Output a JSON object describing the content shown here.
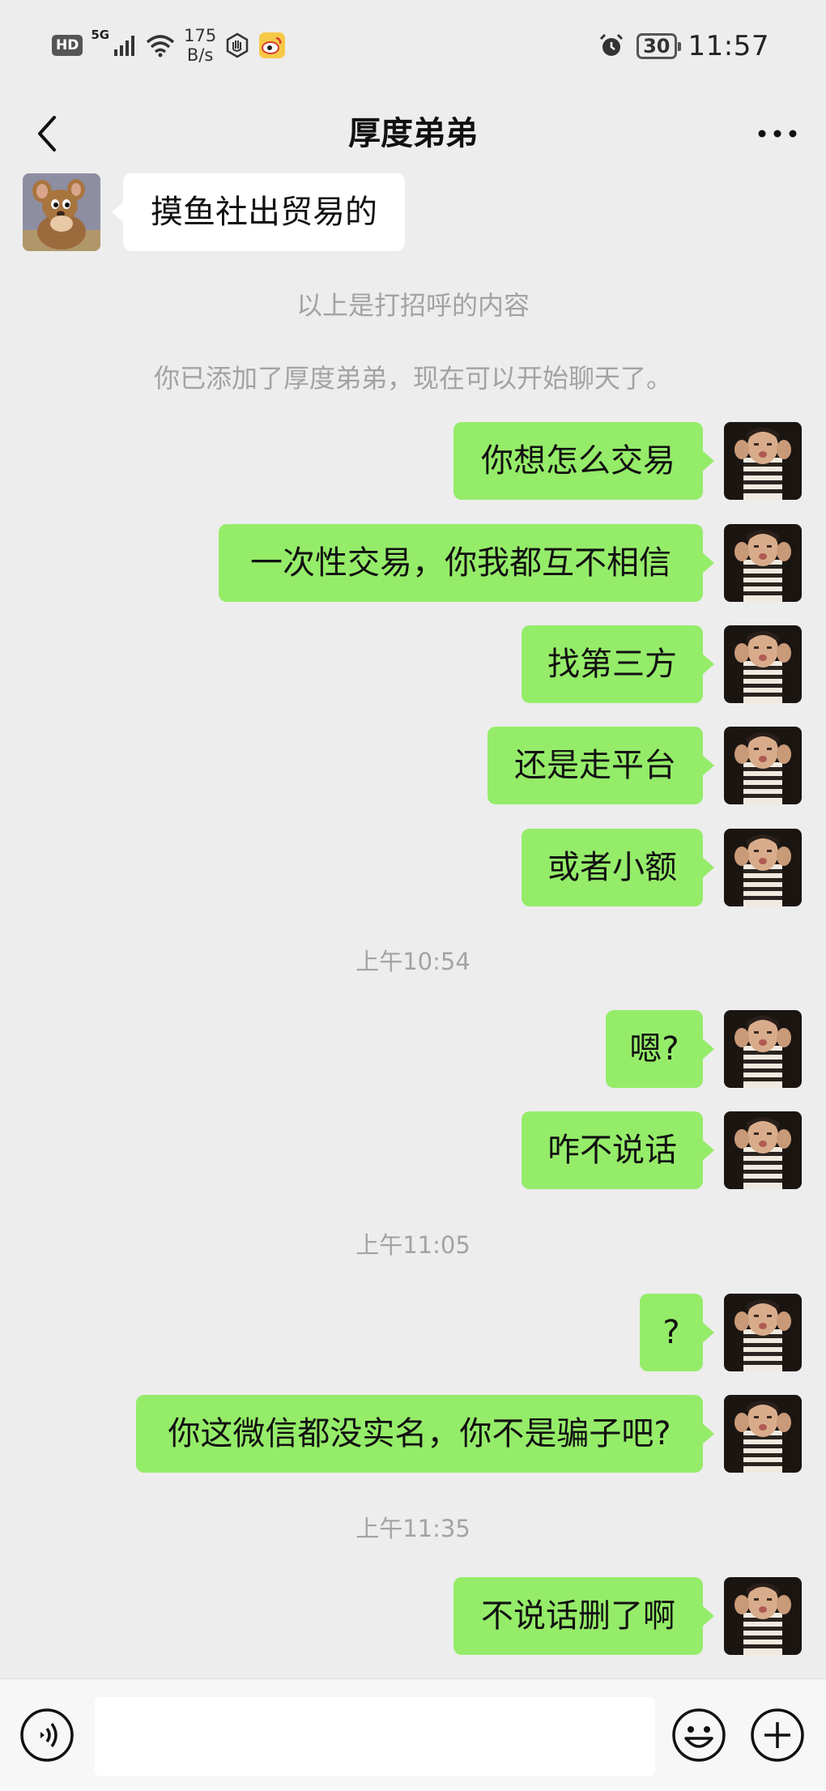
{
  "status_bar": {
    "hd": "HD",
    "network": "5G",
    "speed_value": "175",
    "speed_unit": "B/s",
    "battery": "30",
    "time": "11:57"
  },
  "header": {
    "title": "厚度弟弟",
    "more": "···"
  },
  "conversation": {
    "greeting": "摸鱼社出贸易的",
    "greeting_notice": "以上是打招呼的内容",
    "added_notice": "你已添加了厚度弟弟，现在可以开始聊天了。",
    "messages": [
      "你想怎么交易",
      "一次性交易，你我都互不相信",
      "找第三方",
      "还是走平台",
      "或者小额",
      "嗯?",
      "咋不说话",
      "?",
      "你这微信都没实名，你不是骗子吧?",
      "不说话删了啊"
    ],
    "timestamps": [
      "上午10:54",
      "上午11:05",
      "上午11:35"
    ]
  },
  "input_bar": {
    "placeholder": ""
  },
  "icons": {
    "back": "chevron-left-icon",
    "more": "more-dots-icon",
    "voice": "voice-icon",
    "emoji": "emoji-icon",
    "plus": "plus-icon"
  },
  "colors": {
    "background": "#ededed",
    "my_bubble": "#95ec69",
    "their_bubble": "#ffffff",
    "system_text": "#a3a3a3"
  }
}
